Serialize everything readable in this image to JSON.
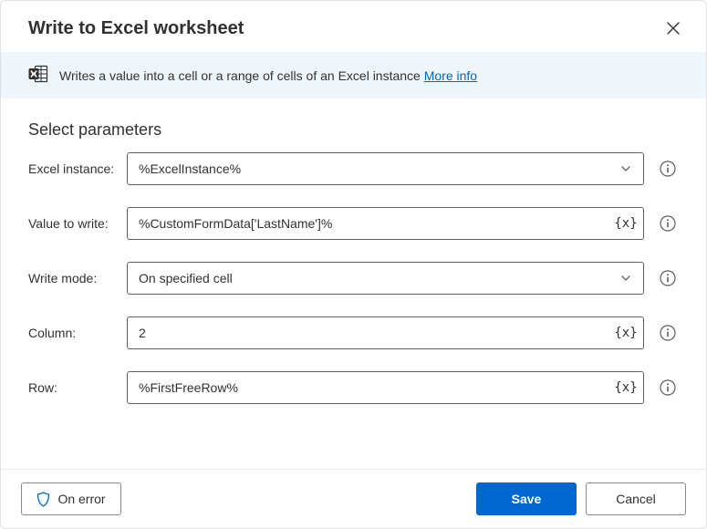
{
  "dialog": {
    "title": "Write to Excel worksheet",
    "description": "Writes a value into a cell or a range of cells of an Excel instance",
    "more_info_label": "More info"
  },
  "section": {
    "heading": "Select parameters"
  },
  "fields": {
    "excel_instance": {
      "label": "Excel instance:",
      "value": "%ExcelInstance%"
    },
    "value_to_write": {
      "label": "Value to write:",
      "value": "%CustomFormData['LastName']%"
    },
    "write_mode": {
      "label": "Write mode:",
      "value": "On specified cell"
    },
    "column": {
      "label": "Column:",
      "value": "2"
    },
    "row": {
      "label": "Row:",
      "value": "%FirstFreeRow%"
    }
  },
  "adornments": {
    "variable_picker": "{x}"
  },
  "footer": {
    "on_error": "On error",
    "save": "Save",
    "cancel": "Cancel"
  }
}
